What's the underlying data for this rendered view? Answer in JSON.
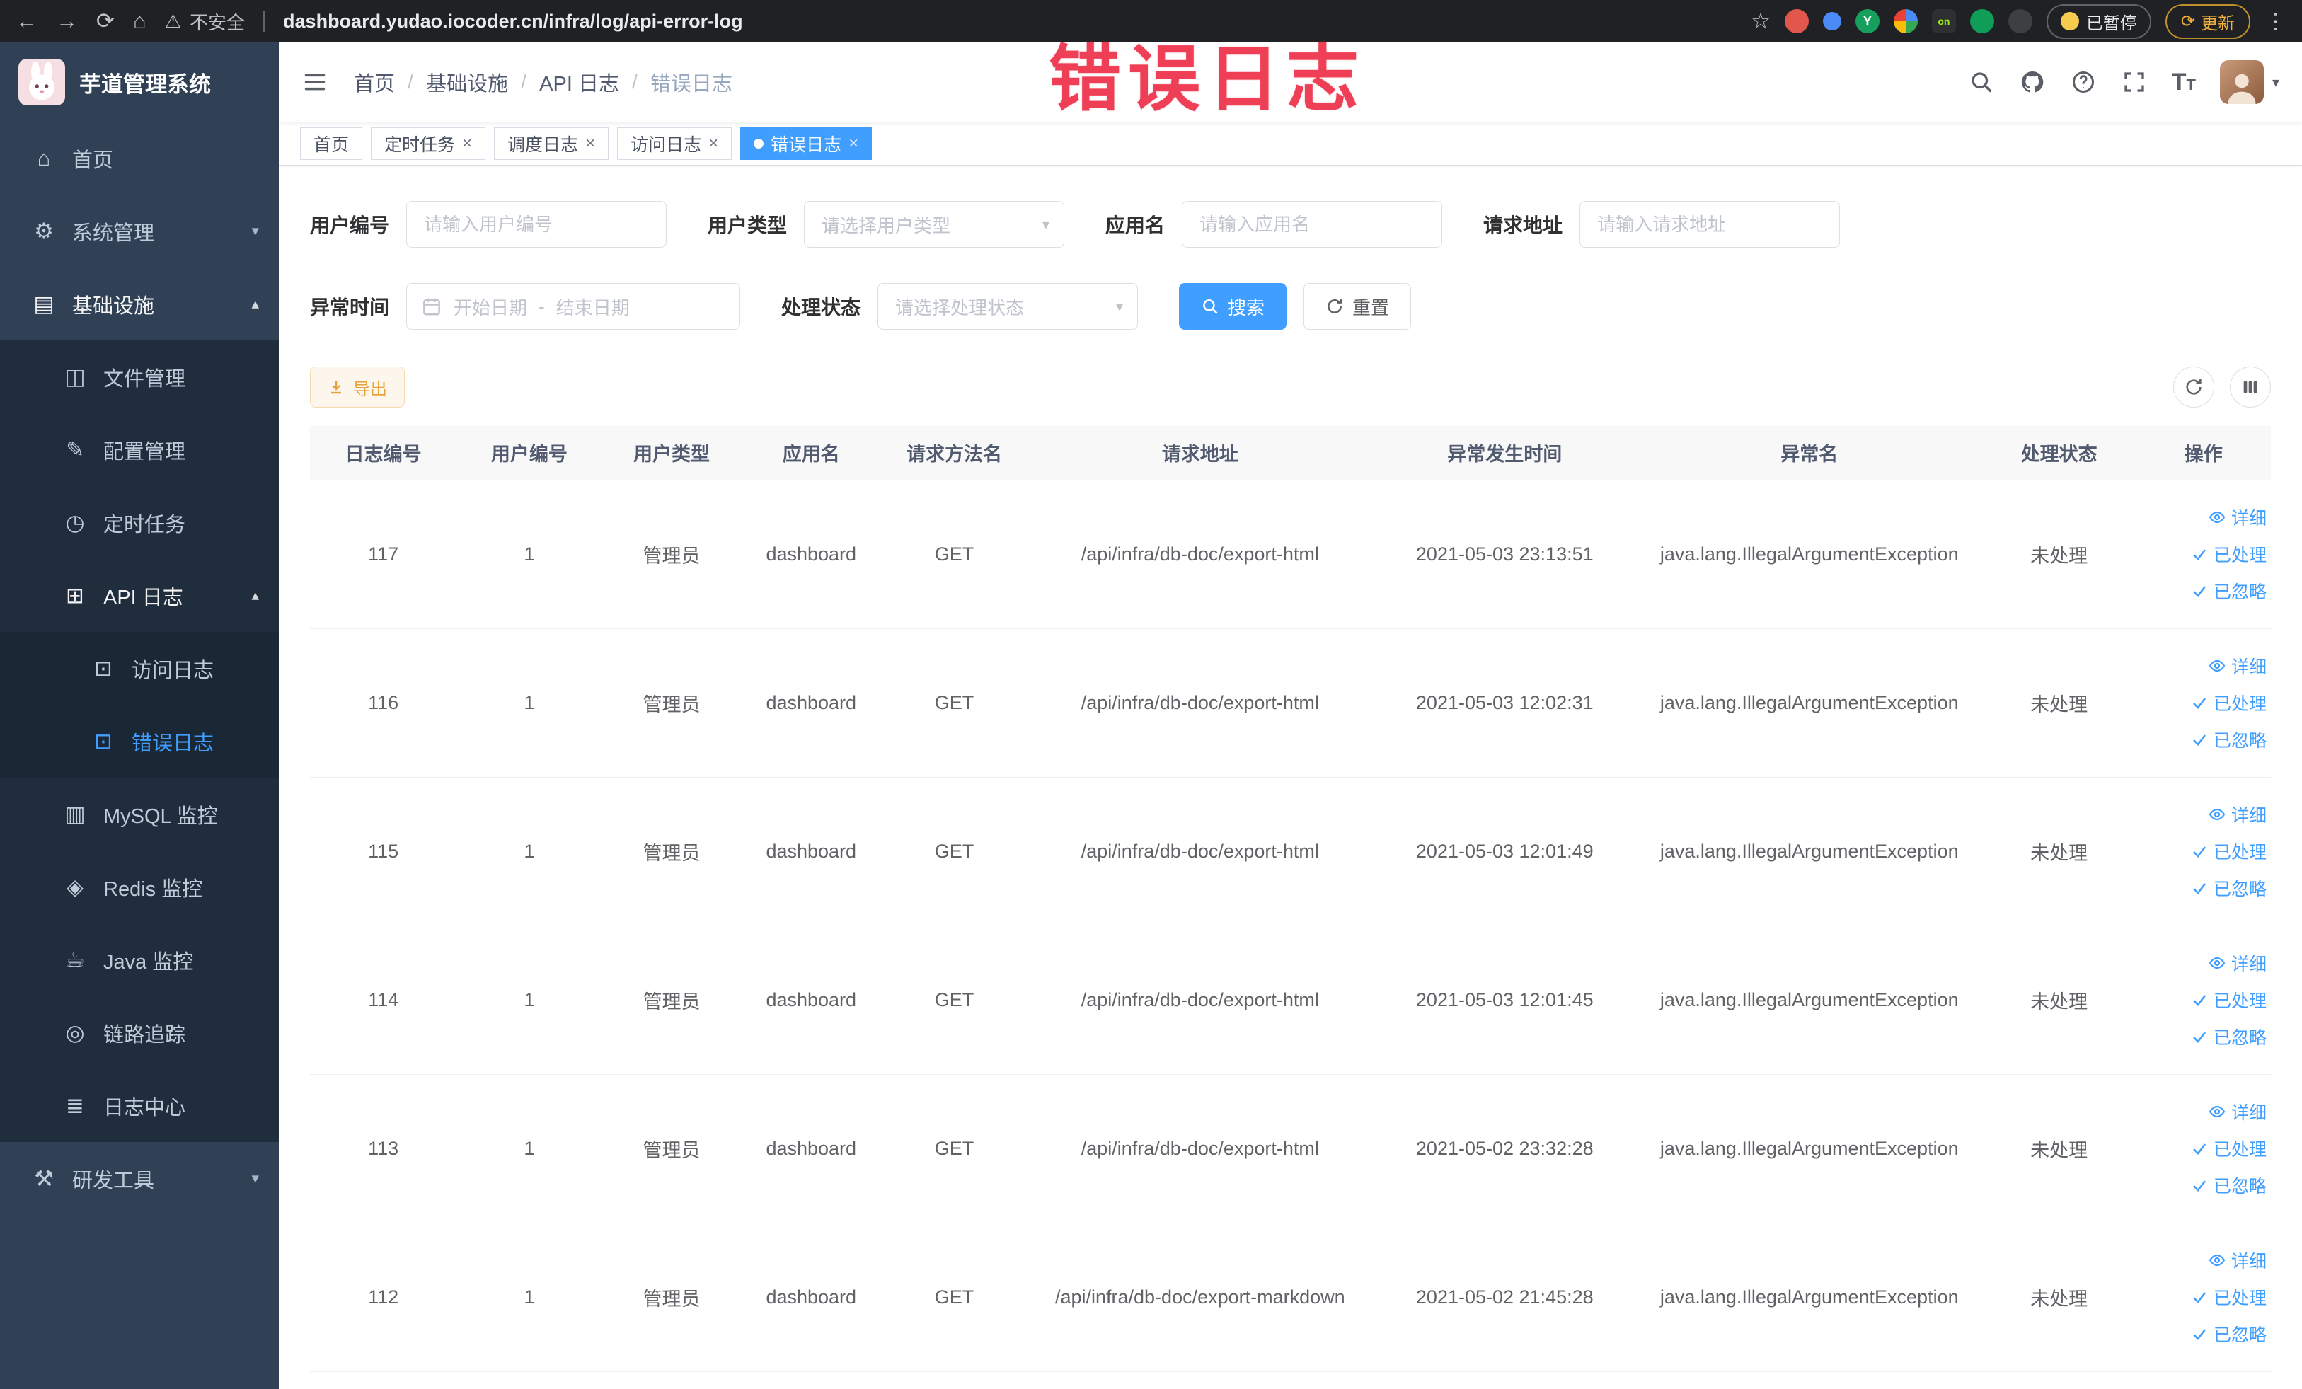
{
  "annotation": {
    "text": "错误日志"
  },
  "browser": {
    "security_label": "不安全",
    "url": "dashboard.yudao.iocoder.cn/infra/log/api-error-log",
    "paused_label": "已暂停",
    "update_label": "更新"
  },
  "sidebar": {
    "logo_title": "芋道管理系统",
    "items": [
      {
        "label": "首页",
        "icon": "home-icon",
        "level": 1
      },
      {
        "label": "系统管理",
        "icon": "gear-icon",
        "level": 1,
        "chevron": "down"
      },
      {
        "label": "基础设施",
        "icon": "monitor-icon",
        "level": 1,
        "chevron": "up",
        "expanded": true
      },
      {
        "label": "文件管理",
        "icon": "file-icon",
        "level": 2
      },
      {
        "label": "配置管理",
        "icon": "edit-icon",
        "level": 2
      },
      {
        "label": "定时任务",
        "icon": "clock-icon",
        "level": 2
      },
      {
        "label": "API 日志",
        "icon": "api-log-icon",
        "level": 2,
        "chevron": "up",
        "expanded": true
      },
      {
        "label": "访问日志",
        "icon": "access-log-icon",
        "level": 3
      },
      {
        "label": "错误日志",
        "icon": "error-log-icon",
        "level": 3,
        "active": true
      },
      {
        "label": "MySQL 监控",
        "icon": "mysql-icon",
        "level": 2
      },
      {
        "label": "Redis 监控",
        "icon": "redis-icon",
        "level": 2
      },
      {
        "label": "Java 监控",
        "icon": "java-icon",
        "level": 2
      },
      {
        "label": "链路追踪",
        "icon": "trace-icon",
        "level": 2
      },
      {
        "label": "日志中心",
        "icon": "log-center-icon",
        "level": 2
      },
      {
        "label": "研发工具",
        "icon": "tools-icon",
        "level": 1,
        "chevron": "down"
      }
    ]
  },
  "header": {
    "breadcrumb": [
      "首页",
      "基础设施",
      "API 日志",
      "错误日志"
    ]
  },
  "tabs": [
    {
      "label": "首页",
      "closable": false,
      "active": false
    },
    {
      "label": "定时任务",
      "closable": true,
      "active": false
    },
    {
      "label": "调度日志",
      "closable": true,
      "active": false
    },
    {
      "label": "访问日志",
      "closable": true,
      "active": false
    },
    {
      "label": "错误日志",
      "closable": true,
      "active": true
    }
  ],
  "filters": {
    "user_id_label": "用户编号",
    "user_id_placeholder": "请输入用户编号",
    "user_type_label": "用户类型",
    "user_type_placeholder": "请选择用户类型",
    "app_name_label": "应用名",
    "app_name_placeholder": "请输入应用名",
    "request_url_label": "请求地址",
    "request_url_placeholder": "请输入请求地址",
    "exception_time_label": "异常时间",
    "start_date_placeholder": "开始日期",
    "date_separator": "-",
    "end_date_placeholder": "结束日期",
    "process_status_label": "处理状态",
    "process_status_placeholder": "请选择处理状态",
    "search_label": "搜索",
    "reset_label": "重置"
  },
  "toolbar": {
    "export_label": "导出"
  },
  "table": {
    "headers": [
      "日志编号",
      "用户编号",
      "用户类型",
      "应用名",
      "请求方法名",
      "请求地址",
      "异常发生时间",
      "异常名",
      "处理状态",
      "操作"
    ],
    "actions": {
      "detail": "详细",
      "processed": "已处理",
      "ignored": "已忽略"
    },
    "rows": [
      {
        "log_id": "117",
        "user_id": "1",
        "user_type": "管理员",
        "app_name": "dashboard",
        "method": "GET",
        "url": "/api/infra/db-doc/export-html",
        "time": "2021-05-03 23:13:51",
        "exception": "java.lang.IllegalArgumentException",
        "status": "未处理"
      },
      {
        "log_id": "116",
        "user_id": "1",
        "user_type": "管理员",
        "app_name": "dashboard",
        "method": "GET",
        "url": "/api/infra/db-doc/export-html",
        "time": "2021-05-03 12:02:31",
        "exception": "java.lang.IllegalArgumentException",
        "status": "未处理"
      },
      {
        "log_id": "115",
        "user_id": "1",
        "user_type": "管理员",
        "app_name": "dashboard",
        "method": "GET",
        "url": "/api/infra/db-doc/export-html",
        "time": "2021-05-03 12:01:49",
        "exception": "java.lang.IllegalArgumentException",
        "status": "未处理"
      },
      {
        "log_id": "114",
        "user_id": "1",
        "user_type": "管理员",
        "app_name": "dashboard",
        "method": "GET",
        "url": "/api/infra/db-doc/export-html",
        "time": "2021-05-03 12:01:45",
        "exception": "java.lang.IllegalArgumentException",
        "status": "未处理"
      },
      {
        "log_id": "113",
        "user_id": "1",
        "user_type": "管理员",
        "app_name": "dashboard",
        "method": "GET",
        "url": "/api/infra/db-doc/export-html",
        "time": "2021-05-02 23:32:28",
        "exception": "java.lang.IllegalArgumentException",
        "status": "未处理"
      },
      {
        "log_id": "112",
        "user_id": "1",
        "user_type": "管理员",
        "app_name": "dashboard",
        "method": "GET",
        "url": "/api/infra/db-doc/export-markdown",
        "time": "2021-05-02 21:45:28",
        "exception": "java.lang.IllegalArgumentException",
        "status": "未处理"
      }
    ]
  },
  "colors": {
    "accent": "#409eff",
    "warning": "#e6a23c",
    "annotation": "#ef3f56",
    "sidebar_bg": "#304156"
  }
}
